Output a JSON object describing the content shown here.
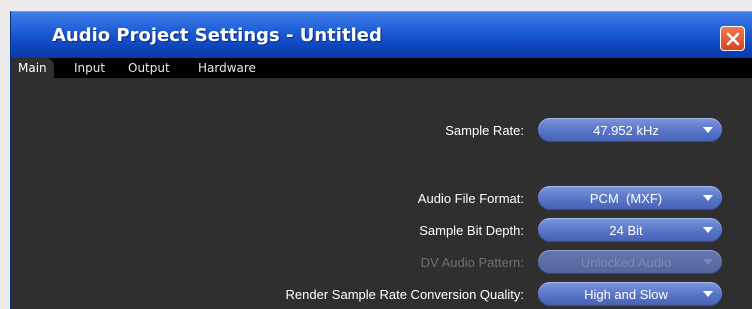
{
  "window": {
    "title": "Audio Project Settings - Untitled"
  },
  "tabs": [
    {
      "label": "Main",
      "active": true
    },
    {
      "label": "Input",
      "active": false
    },
    {
      "label": "Output",
      "active": false
    },
    {
      "label": "Hardware",
      "active": false
    }
  ],
  "settings": {
    "sample_rate": {
      "label": "Sample Rate:",
      "value": "47.952 kHz",
      "enabled": true
    },
    "audio_file_format": {
      "label": "Audio File Format:",
      "value": "PCM  (MXF)",
      "enabled": true
    },
    "sample_bit_depth": {
      "label": "Sample Bit Depth:",
      "value": "24 Bit",
      "enabled": true
    },
    "dv_audio_pattern": {
      "label": "DV Audio Pattern:",
      "value": "Unlocked Audio",
      "enabled": false
    },
    "render_src_quality": {
      "label": "Render Sample Rate Conversion Quality:",
      "value": "High and Slow",
      "enabled": true
    }
  },
  "colors": {
    "titlebar": "#1f5fd6",
    "panel": "#2f2f2f",
    "dropdown": "#5d79cb",
    "close_button": "#e0522a"
  },
  "icons": {
    "close": "close-icon",
    "dropdown_arrow": "chevron-down-icon"
  }
}
